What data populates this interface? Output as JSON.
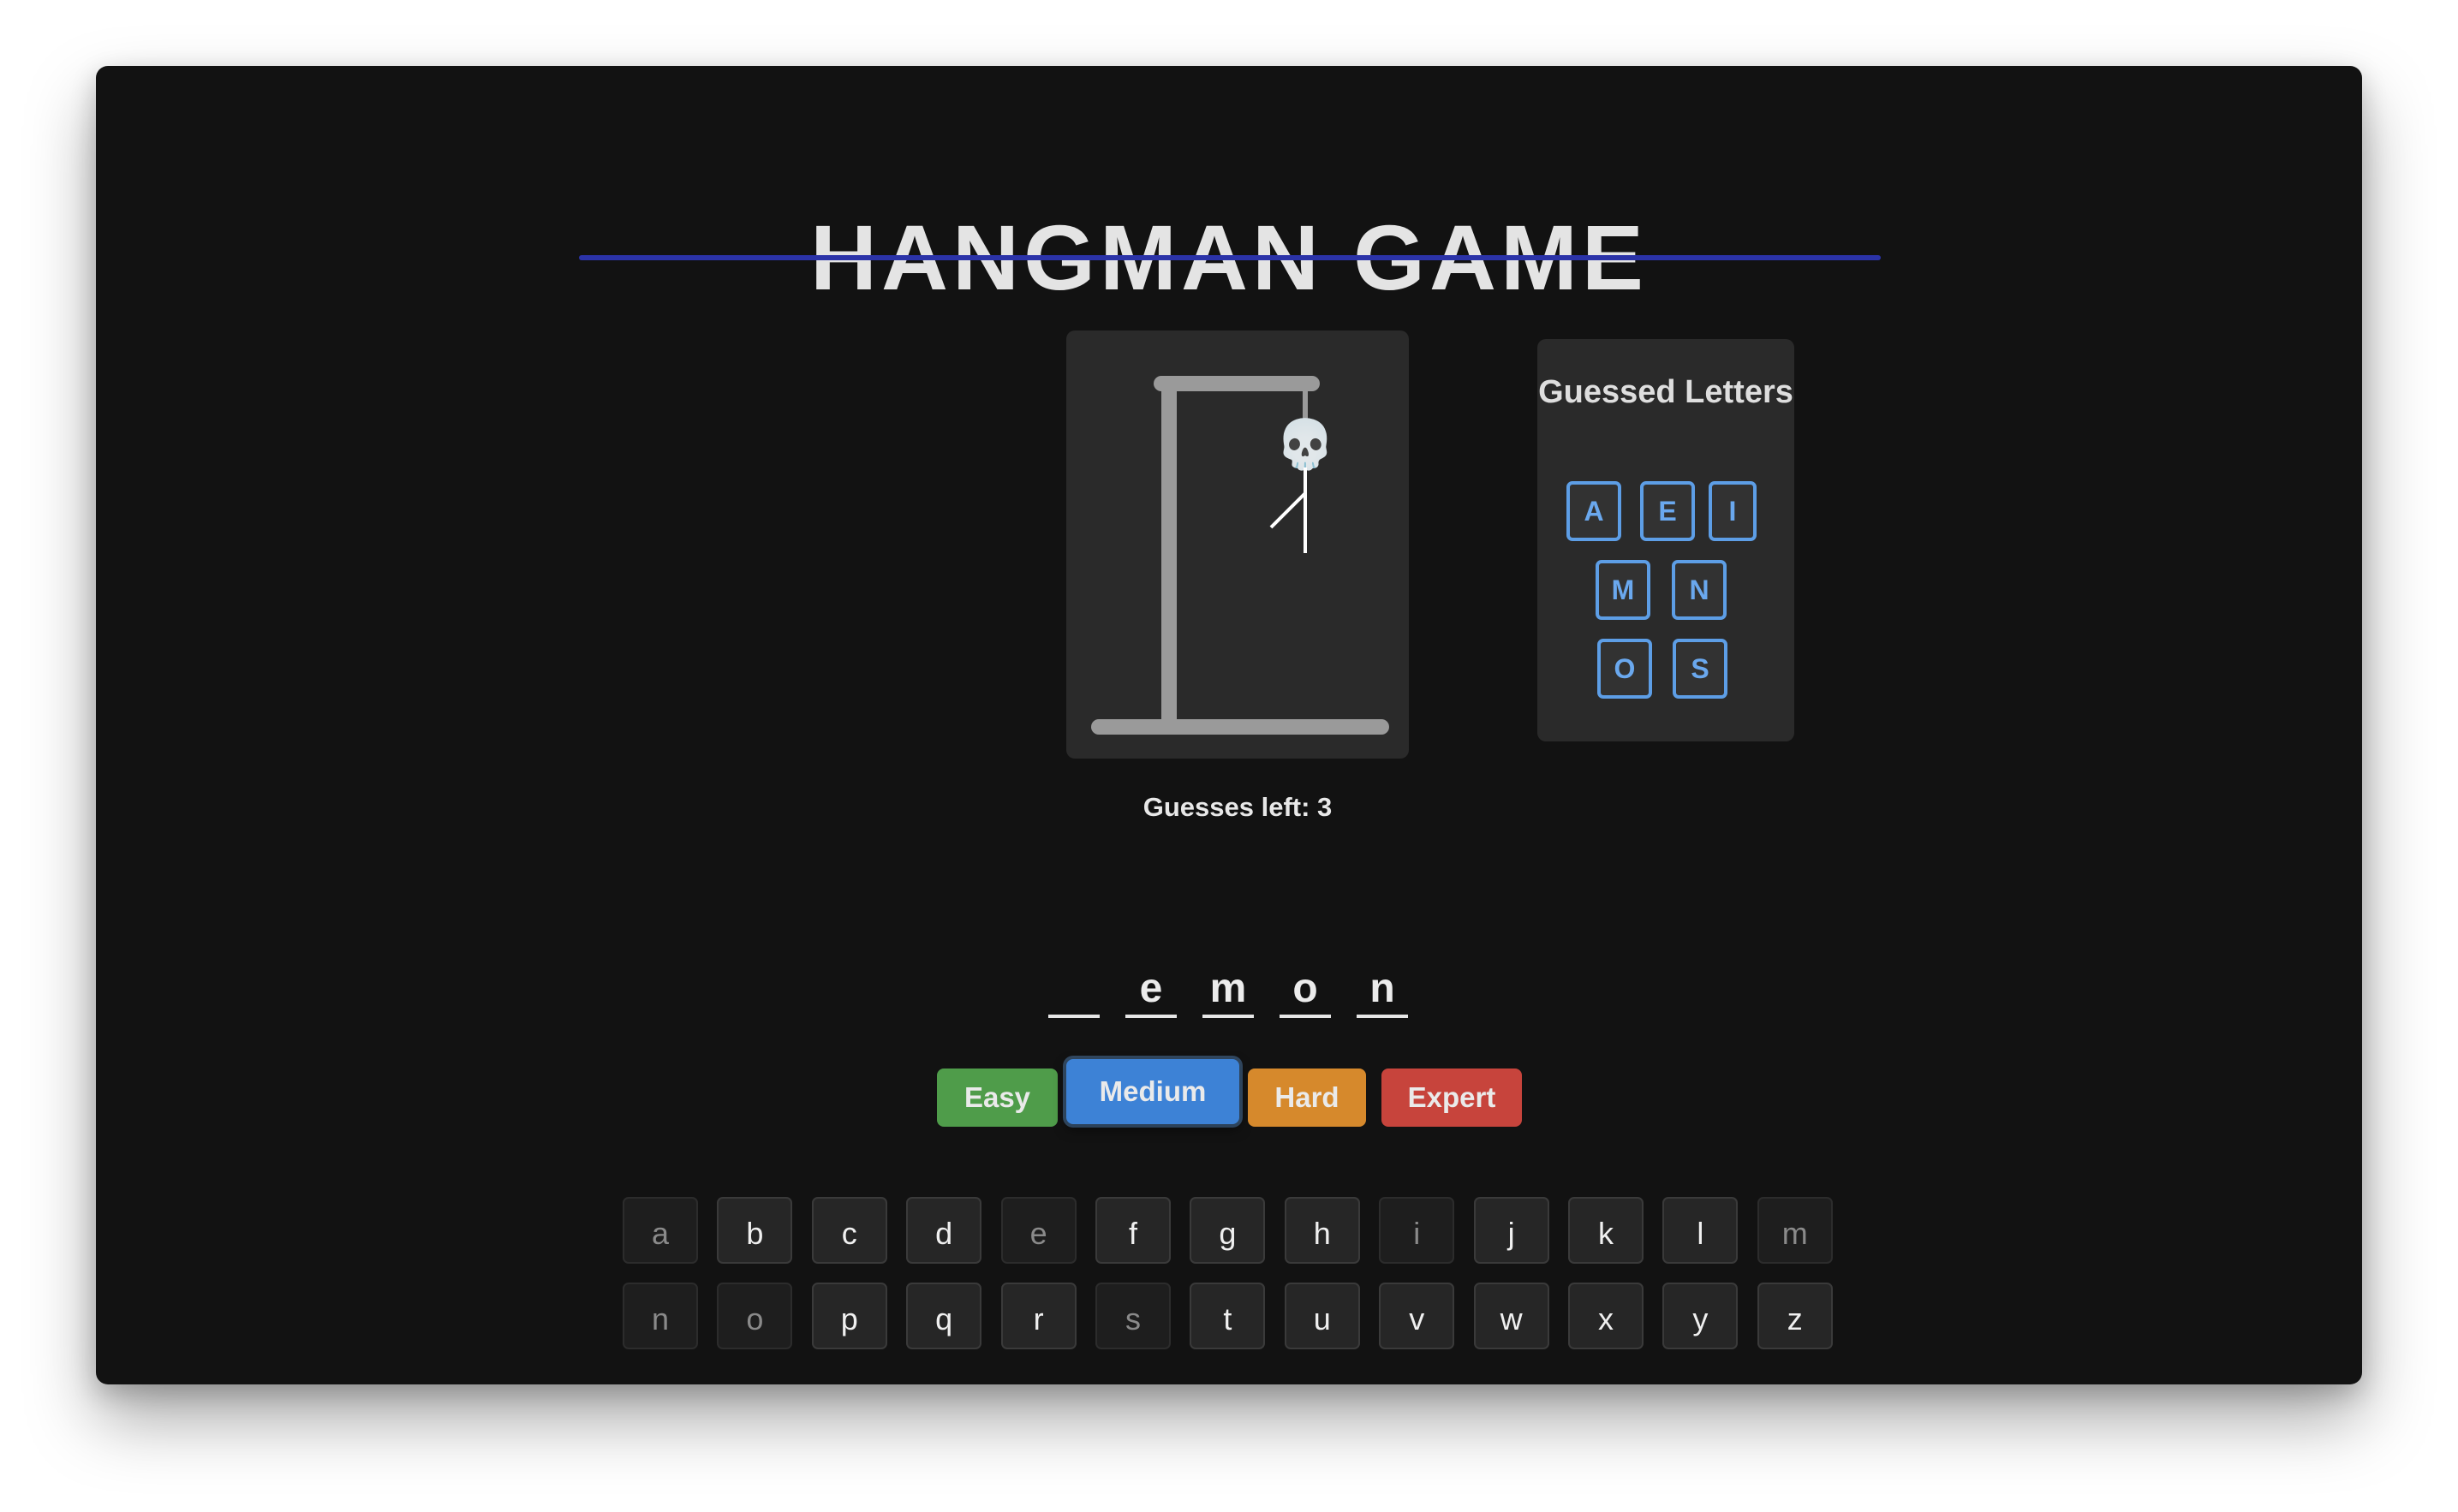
{
  "title": "HANGMAN GAME",
  "guessed": {
    "title": "Guessed Letters",
    "letters": [
      "A",
      "E",
      "I",
      "M",
      "N",
      "O",
      "S"
    ]
  },
  "status": {
    "guesses_left": "Guesses left: 3"
  },
  "word": {
    "slots": [
      "",
      "e",
      "m",
      "o",
      "n"
    ]
  },
  "difficulty": {
    "options": [
      {
        "label": "Easy",
        "color": "#4f9c4a"
      },
      {
        "label": "Medium",
        "color": "#3d82d6"
      },
      {
        "label": "Hard",
        "color": "#d6892c"
      },
      {
        "label": "Expert",
        "color": "#c7443c"
      }
    ],
    "selected": "Medium"
  },
  "keyboard": {
    "keys": [
      "a",
      "b",
      "c",
      "d",
      "e",
      "f",
      "g",
      "h",
      "i",
      "j",
      "k",
      "l",
      "m",
      "n",
      "o",
      "p",
      "q",
      "r",
      "s",
      "t",
      "u",
      "v",
      "w",
      "x",
      "y",
      "z"
    ],
    "used": [
      "a",
      "e",
      "i",
      "m",
      "n",
      "o",
      "s"
    ]
  },
  "hangman": {
    "head_glyph": "💀",
    "parts_drawn": [
      "head",
      "body",
      "left-arm"
    ]
  }
}
